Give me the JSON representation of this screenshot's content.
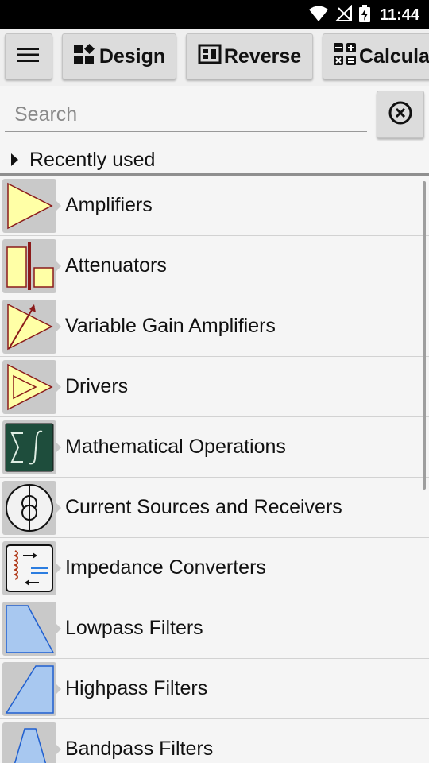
{
  "status": {
    "time": "11:44"
  },
  "toolbar": {
    "design_label": "Design",
    "reverse_label": "Reverse",
    "calculator_label": "Calculator"
  },
  "search": {
    "placeholder": "Search",
    "value": ""
  },
  "recent": {
    "label": "Recently used"
  },
  "categories": [
    {
      "label": "Amplifiers",
      "icon": "amplifier-icon"
    },
    {
      "label": "Attenuators",
      "icon": "attenuator-icon"
    },
    {
      "label": "Variable Gain Amplifiers",
      "icon": "variable-gain-amplifier-icon"
    },
    {
      "label": "Drivers",
      "icon": "driver-icon"
    },
    {
      "label": "Mathematical Operations",
      "icon": "math-operations-icon"
    },
    {
      "label": "Current Sources and Receivers",
      "icon": "current-source-icon"
    },
    {
      "label": "Impedance Converters",
      "icon": "impedance-converter-icon"
    },
    {
      "label": "Lowpass Filters",
      "icon": "lowpass-filter-icon"
    },
    {
      "label": "Highpass Filters",
      "icon": "highpass-filter-icon"
    },
    {
      "label": "Bandpass Filters",
      "icon": "bandpass-filter-icon"
    }
  ],
  "colors": {
    "amplifier_fill": "#ffffa6",
    "component_stroke": "#8b1a1a",
    "math_bg": "#1e4d3c",
    "filter_fill": "#a8c8f0",
    "filter_stroke": "#1f5fd0"
  }
}
